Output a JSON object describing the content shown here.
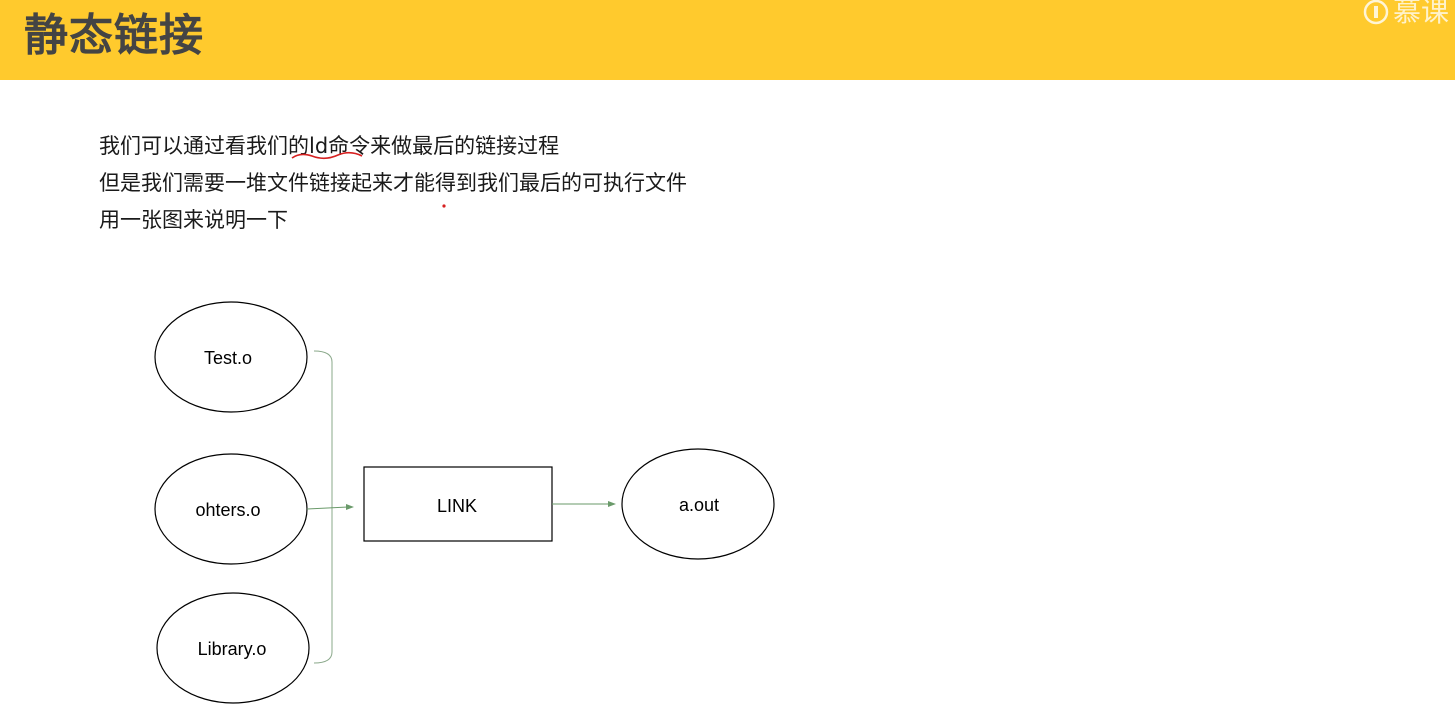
{
  "header": {
    "title": "静态链接",
    "watermark": "慕课",
    "accent_color": "#ffca2d"
  },
  "body": {
    "lines": [
      "我们可以通过看我们的ld命令来做最后的链接过程",
      "但是我们需要一堆文件链接起来才能得到我们最后的可执行文件",
      "用一张图来说明一下"
    ]
  },
  "diagram": {
    "inputs": [
      {
        "label": "Test.o"
      },
      {
        "label": "ohters.o"
      },
      {
        "label": "Library.o"
      }
    ],
    "process": {
      "label": "LINK"
    },
    "output": {
      "label": "a.out"
    },
    "arrow_color": "#6a9a6a"
  }
}
